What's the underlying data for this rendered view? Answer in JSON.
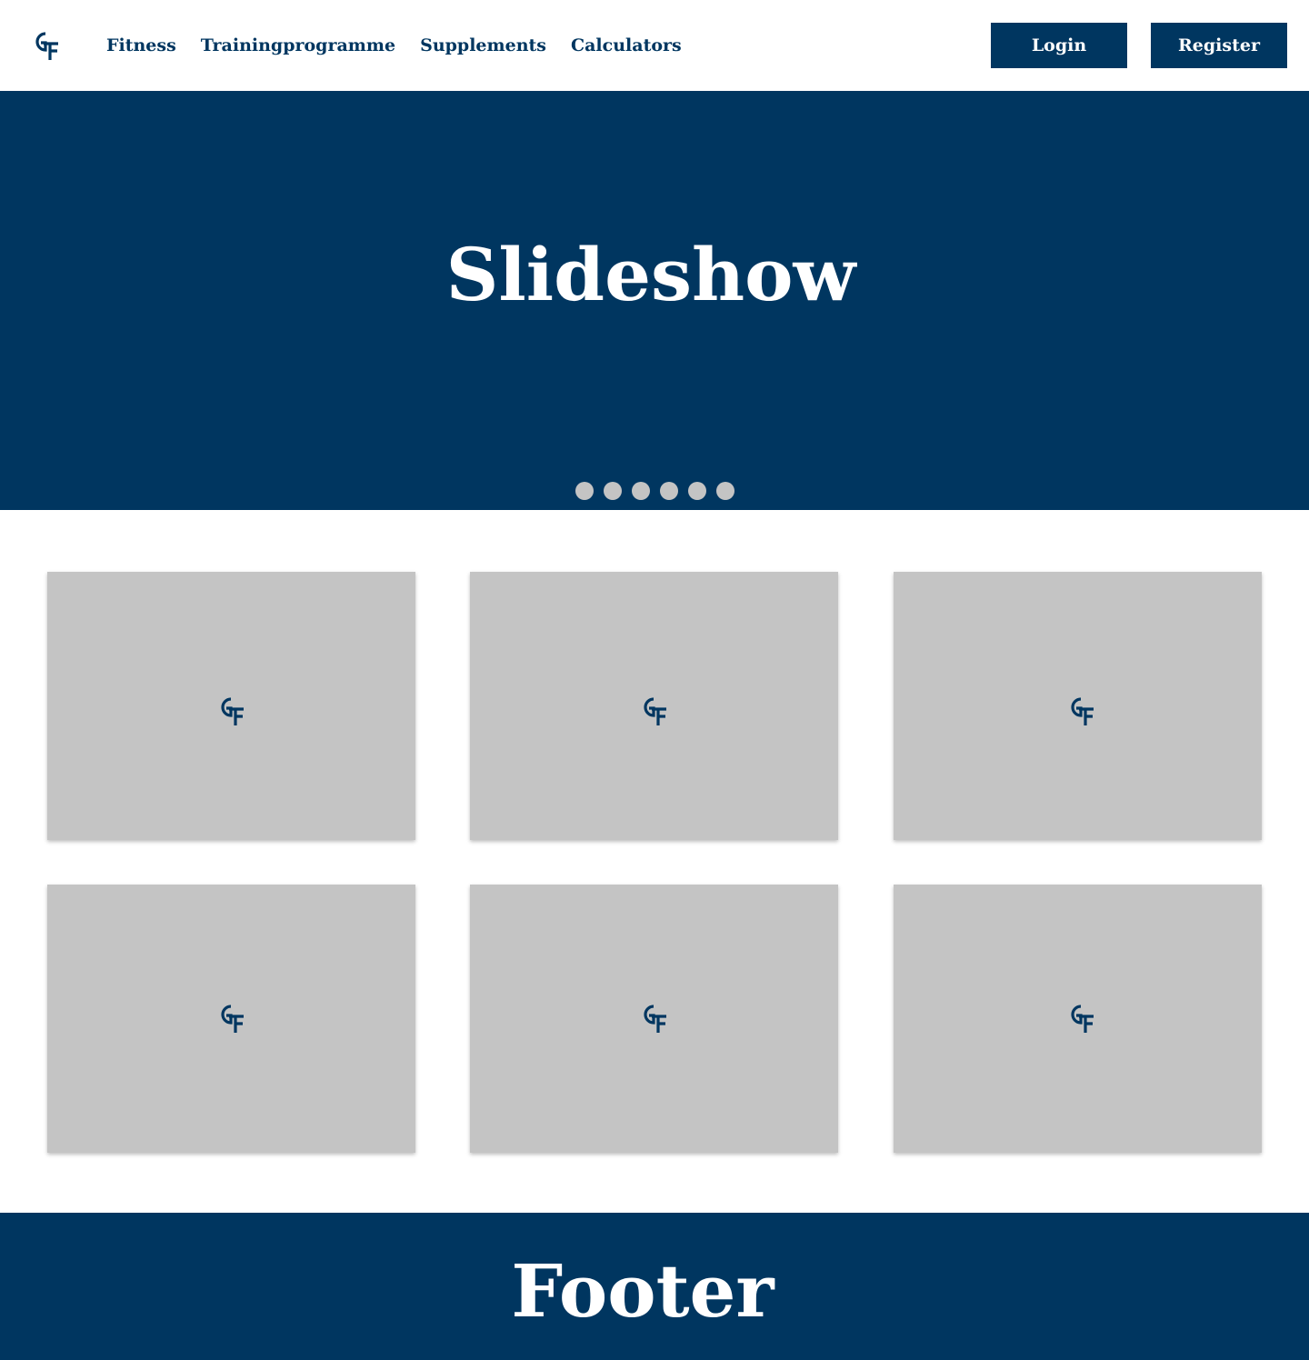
{
  "header": {
    "logo_icon": "gf-logo-icon",
    "nav": [
      {
        "label": "Fitness"
      },
      {
        "label": "Trainingprogramme"
      },
      {
        "label": "Supplements"
      },
      {
        "label": "Calculators"
      }
    ],
    "login_label": "Login",
    "register_label": "Register"
  },
  "hero": {
    "title": "Slideshow",
    "slide_count": 6
  },
  "cards": [
    {
      "icon": "gf-logo-icon"
    },
    {
      "icon": "gf-logo-icon"
    },
    {
      "icon": "gf-logo-icon"
    },
    {
      "icon": "gf-logo-icon"
    },
    {
      "icon": "gf-logo-icon"
    },
    {
      "icon": "gf-logo-icon"
    }
  ],
  "footer": {
    "title": "Footer"
  },
  "colors": {
    "brand": "#003660",
    "card_placeholder": "#C4C4C4",
    "background": "#FFFFFF"
  }
}
